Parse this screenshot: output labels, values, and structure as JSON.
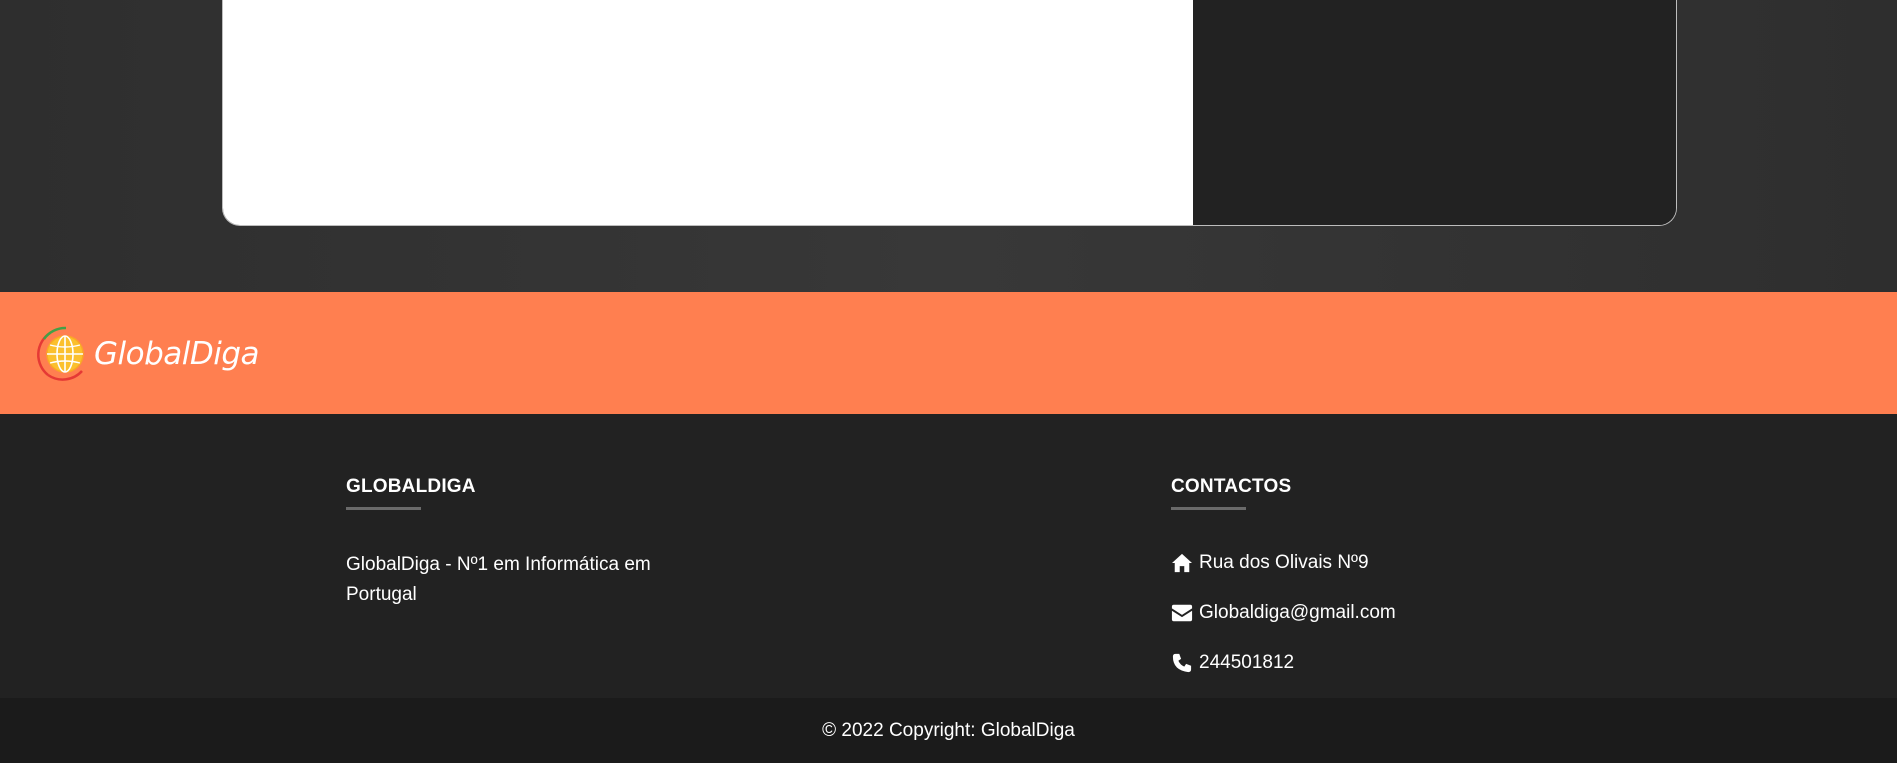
{
  "brand": {
    "name": "GlobalDiga",
    "accent_color": "#ff7f50",
    "logo_icon": "globe-icon"
  },
  "footer": {
    "about": {
      "title": "GLOBALDIGA",
      "description": "GlobalDiga - Nº1 em Informática em Portugal"
    },
    "contacts": {
      "title": "CONTACTOS",
      "items": [
        {
          "icon": "home-icon",
          "text": "Rua dos Olivais Nº9"
        },
        {
          "icon": "envelope-icon",
          "text": "Globaldiga@gmail.com"
        },
        {
          "icon": "phone-icon",
          "text": "244501812"
        }
      ]
    },
    "copyright": "© 2022 Copyright: GlobalDiga"
  }
}
